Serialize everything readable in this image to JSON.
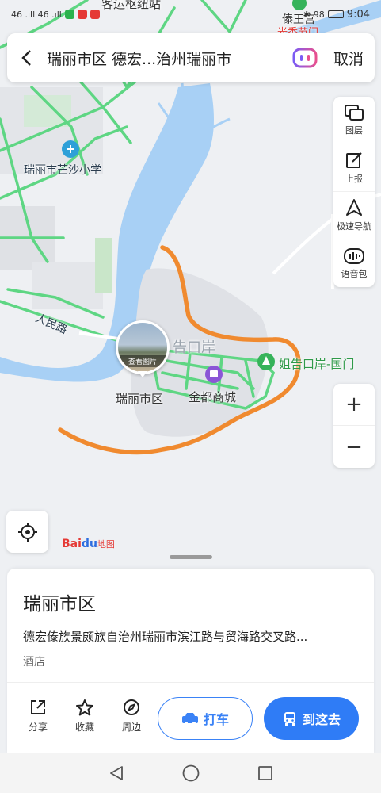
{
  "status_bar": {
    "left": "46 .ıll 46 .ıll",
    "time": "9:04",
    "battery": "98"
  },
  "map": {
    "labels": {
      "top_station": "客运枢纽站",
      "top_right_poi": "傣王宫",
      "top_right_sub": "光秃节门",
      "school": "瑞丽市芒沙小学",
      "road": "人民路",
      "port_dim": "告口岸",
      "district": "瑞丽市区",
      "mall": "金都商城",
      "gate": "姐告口岸-国门",
      "photo_caption": "查看图片"
    },
    "colors": {
      "road": "#5ed683",
      "river": "#a8d0f5",
      "route": "#f08a2f",
      "poi_green": "#2f9a49"
    }
  },
  "search": {
    "text": "瑞丽市区 德宏...治州瑞丽市",
    "cancel": "取消"
  },
  "tools": [
    {
      "label": "图层",
      "icon": "layers-icon"
    },
    {
      "label": "上报",
      "icon": "report-icon"
    },
    {
      "label": "极速导航",
      "icon": "navigation-icon"
    },
    {
      "label": "语音包",
      "icon": "voice-pack-icon"
    }
  ],
  "zoom": {
    "plus": "+",
    "minus": "−"
  },
  "logo": {
    "part1": "Bai",
    "part2": "du",
    "part3": "地图"
  },
  "place": {
    "name": "瑞丽市区",
    "address": "德宏傣族景颇族自治州瑞丽市滨江路与贸海路交叉路...",
    "category": "酒店"
  },
  "actions": {
    "share": "分享",
    "favorite": "收藏",
    "nearby": "周边",
    "taxi": "打车",
    "go": "到这去"
  }
}
